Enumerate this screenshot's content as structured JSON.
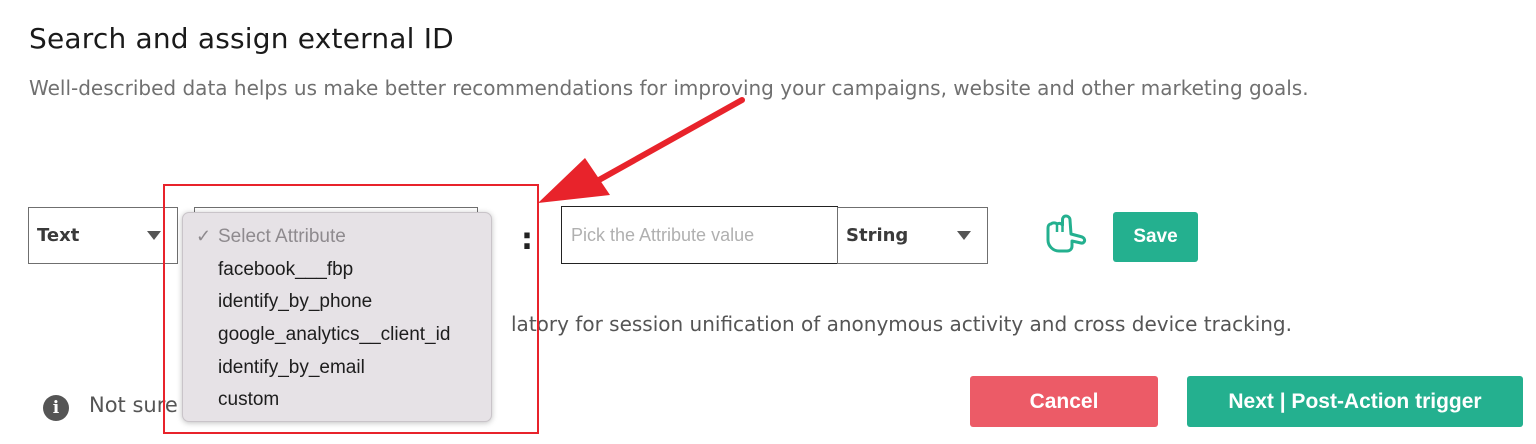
{
  "header": {
    "title": "Search and assign external ID",
    "description": "Well-described data helps us make better recommendations for improving your campaigns, website and other marketing goals."
  },
  "form": {
    "type_select": {
      "value": "Text"
    },
    "attribute_dropdown": {
      "items": [
        "Select Attribute",
        "facebook___fbp",
        "identify_by_phone",
        "google_analytics__client_id",
        "identify_by_email",
        "custom"
      ],
      "selected_index": 0
    },
    "colon": ":",
    "value_input": {
      "placeholder": "Pick the Attribute value",
      "value": ""
    },
    "datatype_select": {
      "value": "String"
    },
    "save_label": "Save"
  },
  "info": {
    "text": "latory for session unification of anonymous activity and cross device tracking.",
    "not_sure": "Not sure"
  },
  "footer": {
    "cancel_label": "Cancel",
    "next_label": "Next | Post-Action trigger"
  },
  "colors": {
    "primary": "#24b08f",
    "danger": "#ec5b67",
    "annotation": "#e8232b"
  },
  "icons": {
    "hand": "pointing-hand-icon",
    "info": "info-icon",
    "caret": "caret-down-icon",
    "check": "checkmark-icon"
  }
}
